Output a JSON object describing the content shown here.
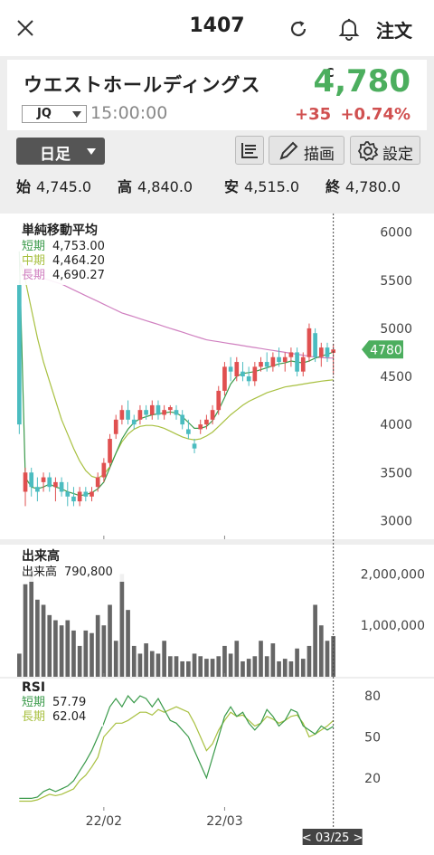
{
  "header": {
    "code": "1407",
    "order_label": "注文"
  },
  "stock": {
    "name": "ウエストホールディングス",
    "market": "JQ",
    "time": "15:00:00",
    "c_mark": "C",
    "price": "4,780",
    "change": "+35",
    "change_pct": "+0.74%"
  },
  "toolbar": {
    "period": "日足",
    "draw_label": "描画",
    "settings_label": "設定"
  },
  "ohlc": [
    {
      "key": "始",
      "value": "4,745.0"
    },
    {
      "key": "高",
      "value": "4,840.0"
    },
    {
      "key": "安",
      "value": "4,515.0"
    },
    {
      "key": "終",
      "value": "4,780.0"
    }
  ],
  "ma_legend": {
    "title": "単純移動平均",
    "rows": [
      {
        "label": "短期",
        "value": "4,753.00",
        "color": "#3a9a4a"
      },
      {
        "label": "中期",
        "value": "4,464.20",
        "color": "#a8c040"
      },
      {
        "label": "長期",
        "value": "4,690.27",
        "color": "#d080c0"
      }
    ]
  },
  "volume_legend": {
    "title": "出来高",
    "label": "出来高",
    "value": "790,800"
  },
  "rsi_legend": {
    "title": "RSI",
    "rows": [
      {
        "label": "短期",
        "value": "57.79",
        "color": "#3a9a4a"
      },
      {
        "label": "長期",
        "value": "62.04",
        "color": "#a8c040"
      }
    ]
  },
  "price_badge": "4780",
  "cursor_date": "< 03/25 >",
  "colors": {
    "up": "#e05050",
    "down": "#4bbcc0",
    "price": "#4cae5e"
  },
  "chart_data": [
    {
      "type": "candlestick",
      "title": "単純移動平均",
      "y_ticks": [
        "6000",
        "5500",
        "5000",
        "4500",
        "4000",
        "3500",
        "3000"
      ],
      "ylim": [
        2900,
        6100
      ],
      "x_ticks": [
        {
          "label": "22/02",
          "index": 14
        },
        {
          "label": "22/03",
          "index": 34
        }
      ],
      "candles": [
        [
          5450,
          5500,
          3900,
          4000
        ],
        [
          3300,
          3550,
          3150,
          3500
        ],
        [
          3500,
          3550,
          3250,
          3350
        ],
        [
          3350,
          3450,
          3200,
          3300
        ],
        [
          3400,
          3500,
          3300,
          3450
        ],
        [
          3450,
          3500,
          3300,
          3350
        ],
        [
          3350,
          3450,
          3200,
          3400
        ],
        [
          3400,
          3450,
          3250,
          3300
        ],
        [
          3300,
          3400,
          3150,
          3250
        ],
        [
          3250,
          3350,
          3150,
          3200
        ],
        [
          3200,
          3350,
          3150,
          3300
        ],
        [
          3300,
          3350,
          3200,
          3250
        ],
        [
          3250,
          3350,
          3200,
          3300
        ],
        [
          3350,
          3500,
          3300,
          3450
        ],
        [
          3450,
          3650,
          3400,
          3600
        ],
        [
          3600,
          3900,
          3550,
          3850
        ],
        [
          3900,
          4100,
          3850,
          4050
        ],
        [
          4050,
          4200,
          4000,
          4150
        ],
        [
          4150,
          4250,
          4000,
          4050
        ],
        [
          4050,
          4100,
          3950,
          4000
        ],
        [
          4050,
          4200,
          4000,
          4150
        ],
        [
          4150,
          4200,
          4050,
          4100
        ],
        [
          4100,
          4250,
          4050,
          4200
        ],
        [
          4200,
          4250,
          4050,
          4100
        ],
        [
          4100,
          4200,
          4050,
          4150
        ],
        [
          4150,
          4200,
          4100,
          4180
        ],
        [
          4150,
          4200,
          4050,
          4100
        ],
        [
          4100,
          4150,
          3950,
          4000
        ],
        [
          3950,
          4050,
          3850,
          3900
        ],
        [
          3800,
          3850,
          3700,
          3750
        ],
        [
          3950,
          4050,
          3900,
          4000
        ],
        [
          4000,
          4100,
          3950,
          4050
        ],
        [
          4050,
          4200,
          4000,
          4150
        ],
        [
          4150,
          4400,
          4100,
          4350
        ],
        [
          4350,
          4650,
          4300,
          4600
        ],
        [
          4600,
          4700,
          4450,
          4550
        ],
        [
          4500,
          4700,
          4450,
          4650
        ],
        [
          4550,
          4650,
          4450,
          4500
        ],
        [
          4500,
          4600,
          4400,
          4450
        ],
        [
          4450,
          4650,
          4400,
          4600
        ],
        [
          4600,
          4700,
          4550,
          4650
        ],
        [
          4650,
          4750,
          4550,
          4600
        ],
        [
          4600,
          4750,
          4550,
          4700
        ],
        [
          4700,
          4800,
          4600,
          4650
        ],
        [
          4650,
          4750,
          4550,
          4700
        ],
        [
          4700,
          4800,
          4600,
          4750
        ],
        [
          4750,
          4800,
          4500,
          4550
        ],
        [
          4550,
          4750,
          4500,
          4700
        ],
        [
          4700,
          5050,
          4650,
          5000
        ],
        [
          4950,
          5000,
          4650,
          4700
        ],
        [
          4700,
          4850,
          4600,
          4800
        ],
        [
          4800,
          4850,
          4650,
          4700
        ],
        [
          4745,
          4840,
          4515,
          4780
        ]
      ],
      "ma_short": [
        5800,
        3450,
        3350,
        3330,
        3350,
        3380,
        3350,
        3330,
        3300,
        3280,
        3260,
        3270,
        3290,
        3330,
        3400,
        3550,
        3700,
        3850,
        3950,
        4020,
        4060,
        4080,
        4100,
        4110,
        4120,
        4130,
        4120,
        4080,
        4020,
        3960,
        3960,
        3980,
        4040,
        4150,
        4280,
        4420,
        4500,
        4530,
        4540,
        4550,
        4570,
        4590,
        4610,
        4630,
        4640,
        4660,
        4650,
        4640,
        4660,
        4690,
        4710,
        4730,
        4753
      ],
      "ma_mid": [
        5700,
        5500,
        5200,
        4900,
        4650,
        4450,
        4250,
        4050,
        3900,
        3750,
        3620,
        3520,
        3460,
        3440,
        3480,
        3560,
        3700,
        3820,
        3900,
        3950,
        3980,
        3990,
        3990,
        3980,
        3960,
        3930,
        3900,
        3870,
        3850,
        3840,
        3850,
        3880,
        3920,
        3980,
        4040,
        4100,
        4150,
        4200,
        4240,
        4270,
        4300,
        4330,
        4350,
        4370,
        4390,
        4400,
        4410,
        4420,
        4430,
        4440,
        4450,
        4458,
        4464
      ],
      "ma_long": [
        5700,
        5600,
        5560,
        5540,
        5520,
        5500,
        5480,
        5460,
        5430,
        5400,
        5370,
        5340,
        5310,
        5280,
        5250,
        5220,
        5190,
        5160,
        5140,
        5120,
        5100,
        5080,
        5060,
        5040,
        5020,
        5000,
        4980,
        4960,
        4940,
        4920,
        4900,
        4880,
        4870,
        4860,
        4850,
        4840,
        4830,
        4820,
        4810,
        4800,
        4790,
        4780,
        4770,
        4760,
        4750,
        4740,
        4730,
        4720,
        4710,
        4700,
        4695,
        4692,
        4690
      ]
    },
    {
      "type": "bar",
      "title": "出来高",
      "y_ticks": [
        "2,000,000",
        "1,000,000"
      ],
      "ylim": [
        0,
        2500000
      ],
      "values": [
        450000,
        1800000,
        2150000,
        1500000,
        1400000,
        1200000,
        1100000,
        1000000,
        1100000,
        900000,
        600000,
        900000,
        850000,
        1200000,
        1000000,
        1400000,
        700000,
        2000000,
        1300000,
        600000,
        450000,
        650000,
        500000,
        450000,
        700000,
        400000,
        400000,
        300000,
        300000,
        450000,
        400000,
        350000,
        350000,
        400000,
        600000,
        450000,
        700000,
        300000,
        350000,
        400000,
        700000,
        400000,
        650000,
        300000,
        350000,
        300000,
        550000,
        350000,
        600000,
        1400000,
        1000000,
        700000,
        790800
      ]
    },
    {
      "type": "line",
      "title": "RSI",
      "y_ticks": [
        "80",
        "50",
        "20"
      ],
      "ylim": [
        0,
        90
      ],
      "series": [
        {
          "name": "短期",
          "values": [
            5,
            5,
            5,
            6,
            10,
            12,
            10,
            12,
            14,
            18,
            25,
            32,
            40,
            50,
            60,
            72,
            78,
            72,
            80,
            75,
            80,
            78,
            72,
            78,
            70,
            62,
            60,
            55,
            50,
            40,
            30,
            20,
            35,
            50,
            65,
            72,
            65,
            68,
            60,
            55,
            60,
            70,
            65,
            58,
            62,
            70,
            68,
            58,
            55,
            52,
            58,
            55,
            57.79
          ]
        },
        {
          "name": "長期",
          "values": [
            3,
            3,
            3,
            4,
            6,
            8,
            7,
            8,
            10,
            12,
            18,
            22,
            28,
            35,
            50,
            55,
            60,
            60,
            62,
            65,
            68,
            68,
            66,
            70,
            68,
            70,
            72,
            70,
            68,
            60,
            50,
            40,
            45,
            55,
            62,
            68,
            65,
            66,
            62,
            58,
            60,
            65,
            63,
            60,
            62,
            65,
            66,
            60,
            50,
            52,
            55,
            58,
            62.04
          ]
        }
      ]
    }
  ]
}
